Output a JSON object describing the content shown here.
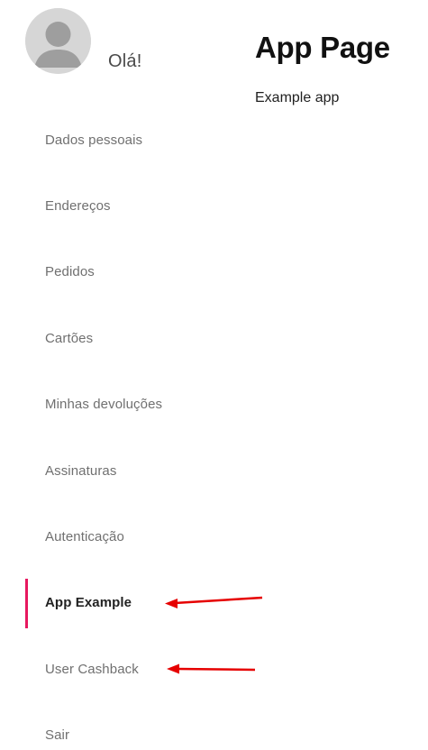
{
  "profile": {
    "avatar_icon": "user-avatar-icon",
    "greeting": "Olá!"
  },
  "main": {
    "title": "App Page",
    "subtitle": "Example app"
  },
  "menu": {
    "items": [
      {
        "label": "Dados pessoais"
      },
      {
        "label": "Endereços"
      },
      {
        "label": "Pedidos"
      },
      {
        "label": "Cartões"
      },
      {
        "label": "Minhas devoluções"
      },
      {
        "label": "Assinaturas"
      },
      {
        "label": "Autenticação"
      },
      {
        "label": "App Example",
        "active": true
      },
      {
        "label": "User Cashback"
      },
      {
        "label": "Sair"
      }
    ]
  },
  "colors": {
    "active_indicator": "#e7185f",
    "annotation_arrow": "#e60000"
  }
}
